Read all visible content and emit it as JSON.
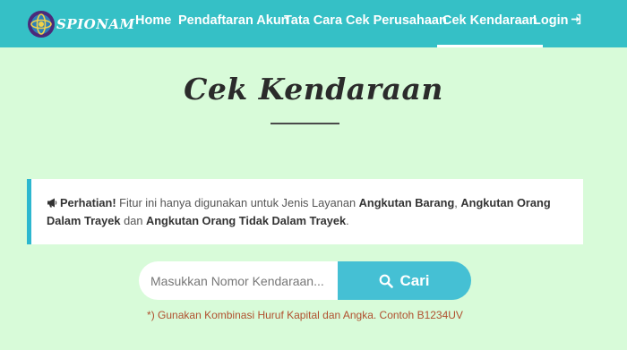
{
  "brand": {
    "name": "SPIONAM"
  },
  "nav": {
    "home": "Home",
    "register": "Pendaftaran Akun",
    "howto": "Tata Cara",
    "company": "Cek Perusahaan",
    "vehicle": "Cek Kendaraan",
    "login": "Login"
  },
  "page": {
    "title": "Cek Kendaraan"
  },
  "alert": {
    "label": "Perhatian!",
    "text1": " Fitur ini hanya digunakan untuk Jenis Layanan ",
    "s1": "Angkutan Barang",
    "text2": ", ",
    "s2": "Angkutan Orang Dalam Trayek",
    "text3": " dan ",
    "s3": "Angkutan Orang Tidak Dalam Trayek",
    "text4": "."
  },
  "search": {
    "placeholder": "Masukkan Nomor Kendaraan...",
    "button_label": "Cari",
    "hint": "*) Gunakan Kombinasi Huruf Kapital dan Angka. Contoh B1234UV"
  },
  "colors": {
    "navbar": "#35c0c6",
    "page_background": "#d8fbd9",
    "search_button": "#45c0d4",
    "alert_border": "#2cb7cf",
    "hint_text": "#b0502e"
  },
  "icons": {
    "logo": "spionam-logo-icon",
    "login": "sign-in-icon",
    "alert": "megaphone-icon",
    "search": "search-icon"
  }
}
